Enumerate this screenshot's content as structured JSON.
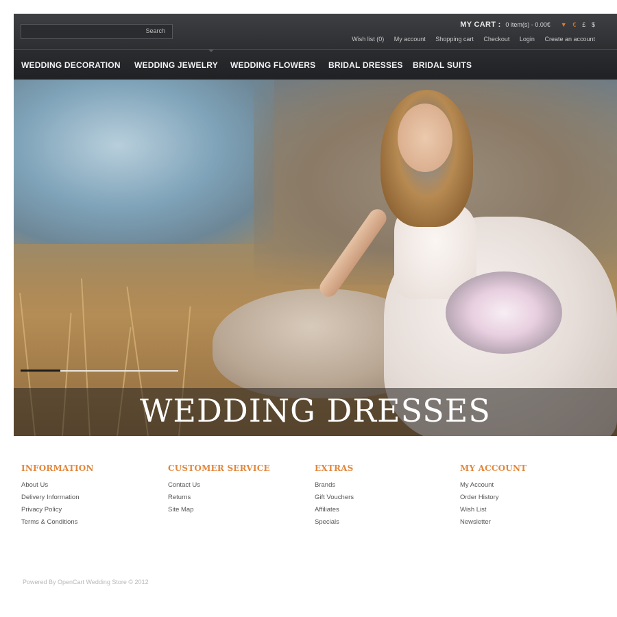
{
  "header": {
    "search": {
      "placeholder": "",
      "button_label": "Search"
    },
    "cart": {
      "label": "MY CART :",
      "value": "0 item(s) - 0.00€",
      "currencies": [
        "€",
        "£",
        "$"
      ]
    },
    "top_links": [
      "Wish list (0)",
      "My account",
      "Shopping cart",
      "Checkout",
      "Login",
      "Create an account"
    ]
  },
  "nav": {
    "items": [
      "WEDDING DECORATION",
      "WEDDING JEWELRY",
      "WEDDING FLOWERS",
      "BRIDAL DRESSES",
      "BRIDAL SUITS"
    ]
  },
  "hero": {
    "title": "WEDDING DRESSES"
  },
  "footer": {
    "columns": [
      {
        "title": "INFORMATION",
        "links": [
          "About Us",
          "Delivery Information",
          "Privacy Policy",
          "Terms & Conditions"
        ]
      },
      {
        "title": "CUSTOMER SERVICE",
        "links": [
          "Contact Us",
          "Returns",
          "Site Map"
        ]
      },
      {
        "title": "EXTRAS",
        "links": [
          "Brands",
          "Gift Vouchers",
          "Affiliates",
          "Specials"
        ]
      },
      {
        "title": "MY ACCOUNT",
        "links": [
          "My Account",
          "Order History",
          "Wish List",
          "Newsletter"
        ]
      }
    ],
    "powered": "Powered By OpenCart Wedding Store © 2012"
  },
  "colors": {
    "accent": "#e2873c",
    "header_bg": "#2c2e31",
    "nav_bg": "#1f2124"
  }
}
